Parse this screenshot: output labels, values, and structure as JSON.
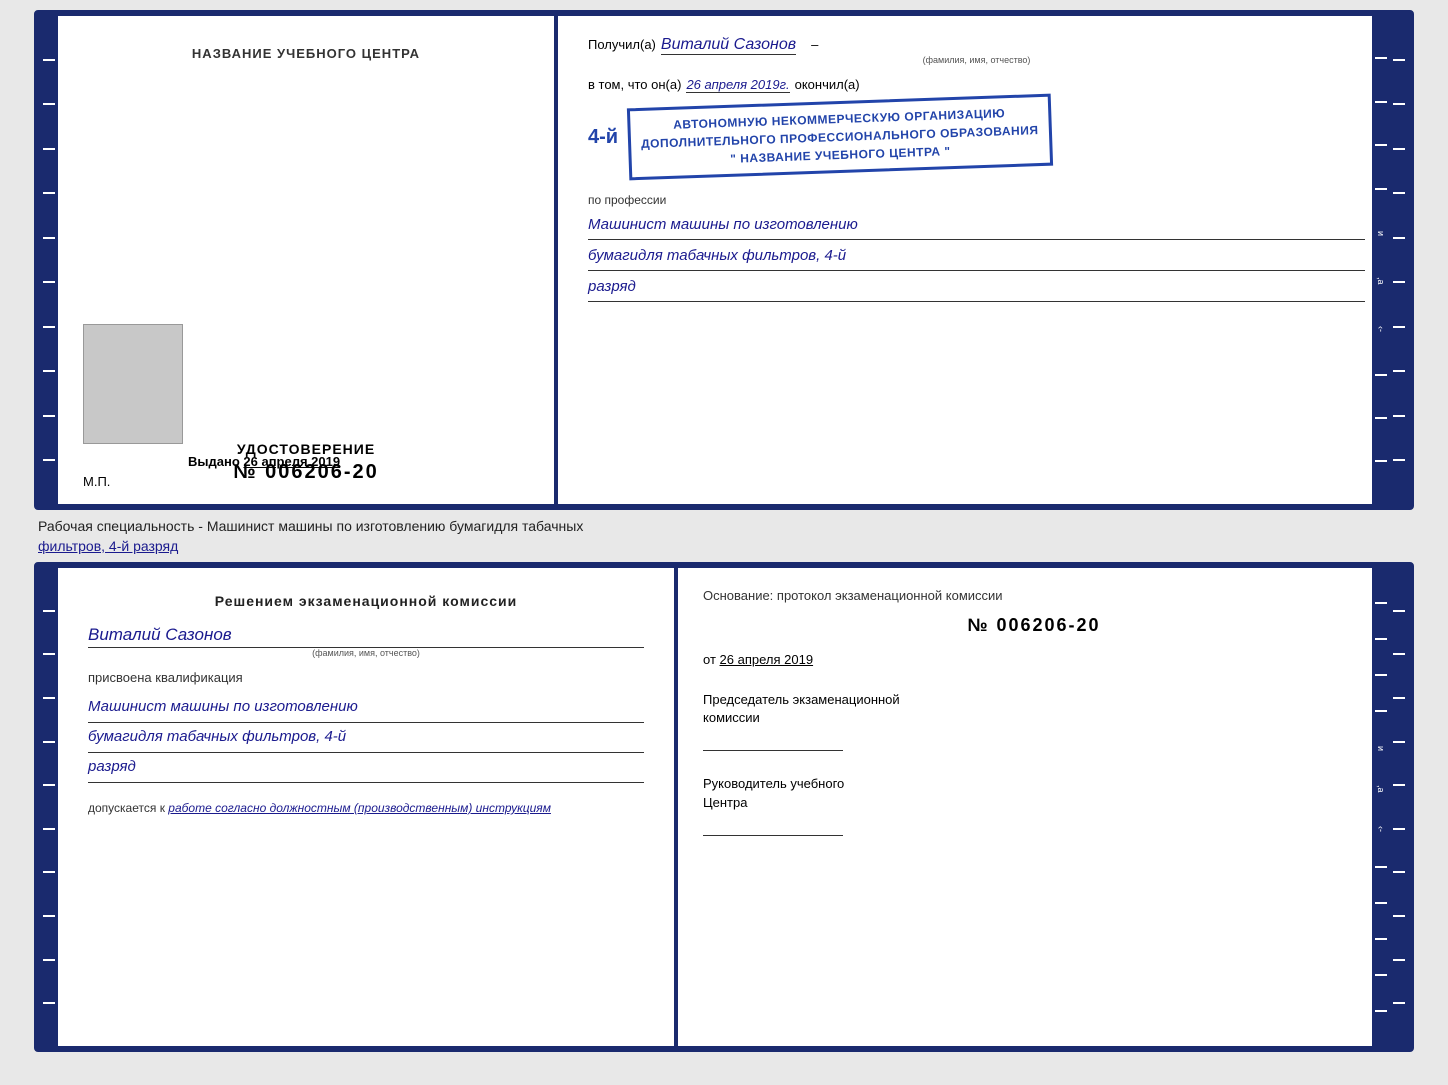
{
  "top_cert": {
    "left": {
      "org_name": "НАЗВАНИЕ УЧЕБНОГО ЦЕНТРА",
      "udostoverenie_label": "УДОСТОВЕРЕНИЕ",
      "number": "№ 006206-20",
      "issued_label": "Выдано",
      "issued_date": "26 апреля 2019",
      "mp_label": "М.П."
    },
    "right": {
      "received_prefix": "Получил(а)",
      "recipient_name": "Виталий Сазонов",
      "recipient_hint": "(фамилия, имя, отчество)",
      "vtom_label": "в том, что он(а)",
      "vtom_date": "26 апреля 2019г.",
      "finished_label": "окончил(а)",
      "stamp_line1": "АВТОНОМНУЮ НЕКОММЕРЧЕСКУЮ ОРГАНИЗАЦИЮ",
      "stamp_line2": "ДОПОЛНИТЕЛЬНОГО ПРОФЕССИОНАЛЬНОГО ОБРАЗОВАНИЯ",
      "stamp_line3": "\" НАЗВАНИЕ УЧЕБНОГО ЦЕНТРА \"",
      "stamp_big": "4-й",
      "prof_label": "по профессии",
      "prof_line1": "Машинист машины по изготовлению",
      "prof_line2": "бумагидля табачных фильтров, 4-й",
      "prof_line3": "разряд"
    }
  },
  "specialty_line": "Рабочая специальность - Машинист машины по изготовлению бумагидля табачных",
  "specialty_line2": "фильтров, 4-й разряд",
  "bottom_cert": {
    "left": {
      "commission_title": "Решением экзаменационной комиссии",
      "name": "Виталий Сазонов",
      "name_hint": "(фамилия, имя, отчество)",
      "assigned_label": "присвоена квалификация",
      "qual_line1": "Машинист машины по изготовлению",
      "qual_line2": "бумагидля табачных фильтров, 4-й",
      "qual_line3": "разряд",
      "dopuskaetsya_prefix": "допускается к",
      "dopuskaetsya_value": "работе согласно должностным (производственным) инструкциям"
    },
    "right": {
      "osnovaniye_label": "Основание: протокол экзаменационной комиссии",
      "number": "№ 006206-20",
      "date_prefix": "от",
      "date": "26 апреля 2019",
      "chairman_label": "Председатель экзаменационной",
      "chairman_label2": "комиссии",
      "director_label": "Руководитель учебного",
      "director_label2": "Центра"
    }
  }
}
